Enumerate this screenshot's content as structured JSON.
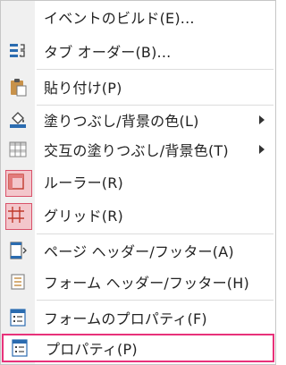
{
  "menu": {
    "items": [
      {
        "label": "イベントのビルド(E)...",
        "icon": "none"
      },
      {
        "label": "タブ オーダー(B)...",
        "icon": "tab-order-icon"
      },
      {
        "label": "貼り付け(P)",
        "icon": "paste-icon"
      },
      {
        "label": "塗りつぶし/背景の色(L)",
        "icon": "fill-color-icon",
        "submenu": true
      },
      {
        "label": "交互の塗りつぶし/背景色(T)",
        "icon": "alternate-fill-icon",
        "submenu": true
      },
      {
        "label": "ルーラー(R)",
        "icon": "ruler-icon",
        "checked": true
      },
      {
        "label": "グリッド(R)",
        "icon": "grid-icon",
        "checked": true
      },
      {
        "label": "ページ ヘッダー/フッター(A)",
        "icon": "page-header-footer-icon"
      },
      {
        "label": "フォーム ヘッダー/フッター(H)",
        "icon": "form-header-footer-icon"
      },
      {
        "label": "フォームのプロパティ(F)",
        "icon": "form-properties-icon"
      },
      {
        "label": "プロパティ(P)",
        "icon": "properties-icon",
        "highlighted": true
      }
    ],
    "colors": {
      "highlight_border": "#e8327a",
      "checked_fill": "#f3c6cb",
      "checked_border": "#d9526a",
      "icon_blue": "#2b6cb0"
    }
  }
}
